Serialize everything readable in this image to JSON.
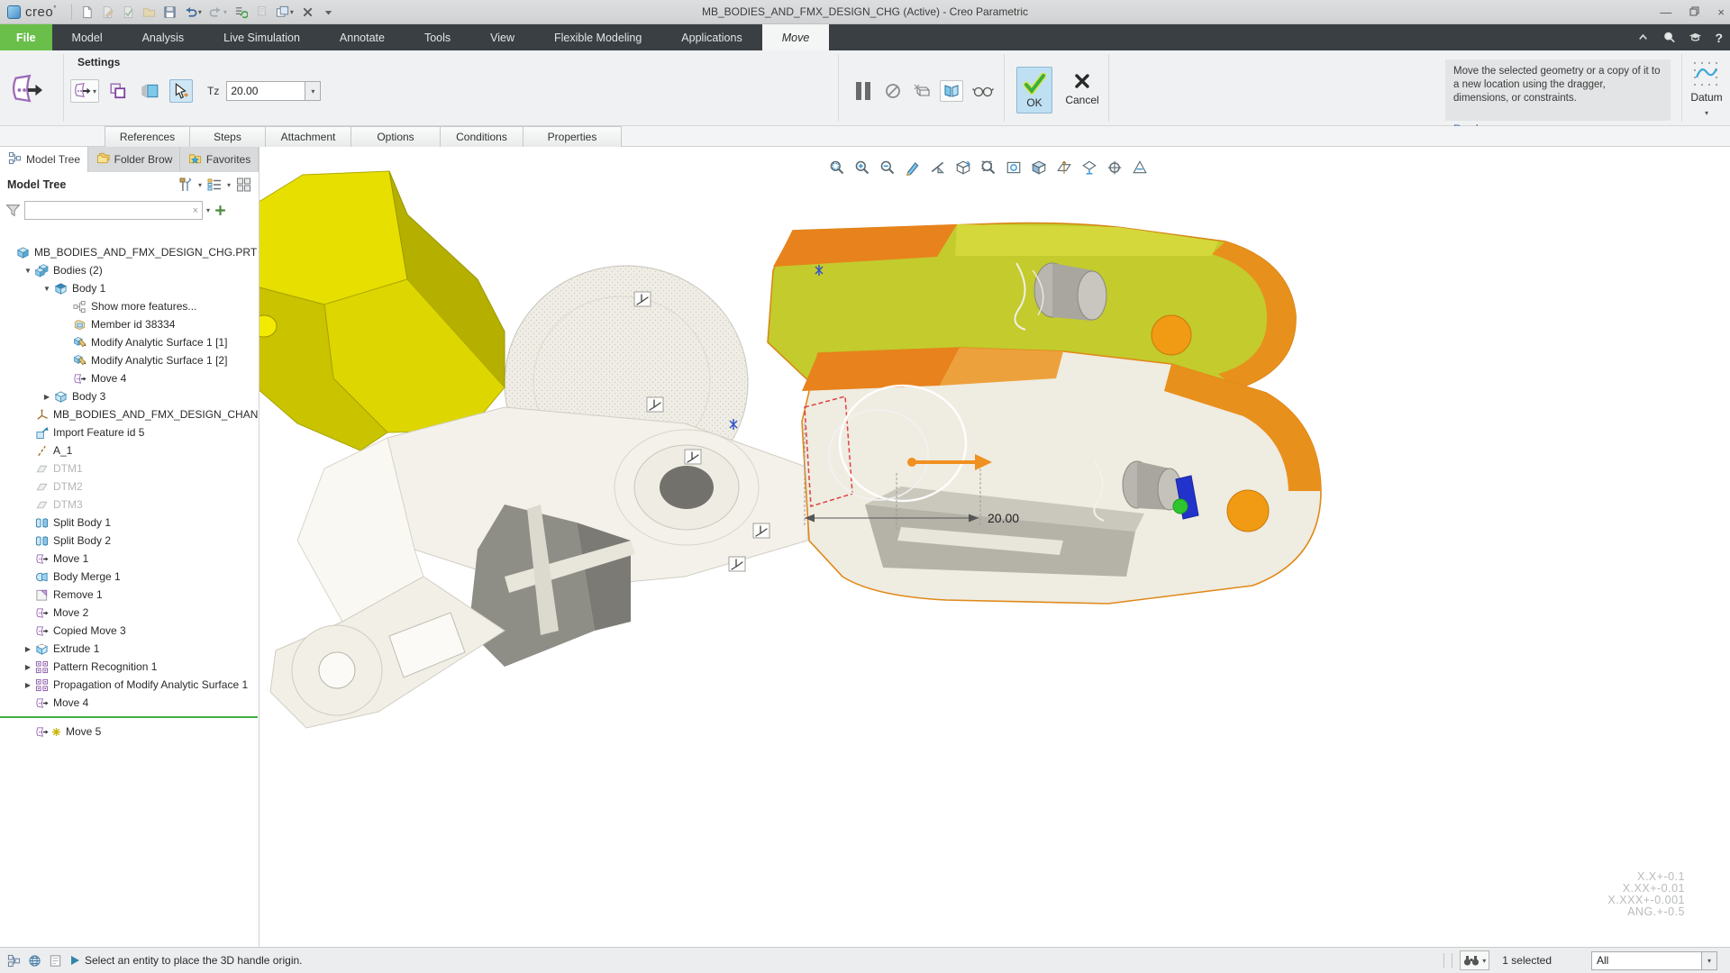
{
  "titlebar": {
    "title": "MB_BODIES_AND_FMX_DESIGN_CHG (Active) - Creo Parametric",
    "logo_text": "creo",
    "quickbar": [
      {
        "name": "new-file",
        "disabled": false
      },
      {
        "name": "sketch-file",
        "disabled": true
      },
      {
        "name": "validate-file",
        "disabled": true
      },
      {
        "name": "open-folder",
        "disabled": true
      },
      {
        "name": "save",
        "disabled": false
      },
      {
        "name": "undo",
        "disabled": false,
        "dropdown": true
      },
      {
        "name": "redo",
        "disabled": true,
        "dropdown": true
      },
      {
        "name": "regenerate",
        "disabled": false
      },
      {
        "name": "print",
        "disabled": true
      },
      {
        "name": "window-arrange",
        "disabled": false,
        "dropdown": true
      },
      {
        "name": "close-window",
        "disabled": false
      },
      {
        "name": "quickbar-customize",
        "disabled": false
      }
    ],
    "window_controls": [
      "minimize",
      "restore",
      "close"
    ]
  },
  "tabs": [
    {
      "label": "File",
      "type": "file"
    },
    {
      "label": "Model"
    },
    {
      "label": "Analysis"
    },
    {
      "label": "Live Simulation"
    },
    {
      "label": "Annotate"
    },
    {
      "label": "Tools"
    },
    {
      "label": "View"
    },
    {
      "label": "Flexible Modeling"
    },
    {
      "label": "Applications"
    },
    {
      "label": "Move",
      "active": true
    }
  ],
  "tabbar_icons": [
    "minimize-ribbon",
    "command-search",
    "learning-connector",
    "help"
  ],
  "ribbon": {
    "settings_label": "Settings",
    "tz_label": "Tz",
    "tz_value": "20.00",
    "ok_label": "OK",
    "cancel_label": "Cancel",
    "info_text": "Move the selected geometry or a copy of it to a new location using the dragger, dimensions, or constraints.",
    "read_more": "Read more...",
    "datum_label": "Datum"
  },
  "dashboard_tabs": [
    "References",
    "Steps",
    "Attachment",
    "Options",
    "Conditions",
    "Properties"
  ],
  "panel": {
    "tabs": [
      {
        "label": "Model Tree",
        "icon": "treetab",
        "active": true
      },
      {
        "label": "Folder Brow",
        "icon": "folders"
      },
      {
        "label": "Favorites",
        "icon": "favfolder"
      }
    ],
    "header": "Model Tree",
    "tree": [
      {
        "label": "MB_BODIES_AND_FMX_DESIGN_CHG.PRT",
        "icon": "part",
        "indent": 0
      },
      {
        "label": "Bodies (2)",
        "icon": "bodies",
        "indent": 1,
        "arrow": "down"
      },
      {
        "label": "Body 1",
        "icon": "body",
        "indent": 2,
        "arrow": "down"
      },
      {
        "label": "Show more features...",
        "icon": "more",
        "indent": 3
      },
      {
        "label": "Member id 38334",
        "icon": "member",
        "indent": 3
      },
      {
        "label": "Modify Analytic Surface 1 [1]",
        "icon": "modify",
        "indent": 3
      },
      {
        "label": "Modify Analytic Surface 1 [2]",
        "icon": "modify",
        "indent": 3
      },
      {
        "label": "Move 4",
        "icon": "move",
        "indent": 3
      },
      {
        "label": "Body 3",
        "icon": "body2",
        "indent": 2,
        "arrow": "right"
      },
      {
        "label": "MB_BODIES_AND_FMX_DESIGN_CHANGE",
        "icon": "csys",
        "indent": 1
      },
      {
        "label": "Import Feature id 5",
        "icon": "import",
        "indent": 1
      },
      {
        "label": "A_1",
        "icon": "axis",
        "indent": 1
      },
      {
        "label": "DTM1",
        "icon": "datum",
        "indent": 1,
        "grayed": true
      },
      {
        "label": "DTM2",
        "icon": "datum",
        "indent": 1,
        "grayed": true
      },
      {
        "label": "DTM3",
        "icon": "datum",
        "indent": 1,
        "grayed": true
      },
      {
        "label": "Split Body 1",
        "icon": "split",
        "indent": 1
      },
      {
        "label": "Split Body 2",
        "icon": "split",
        "indent": 1
      },
      {
        "label": "Move 1",
        "icon": "move",
        "indent": 1
      },
      {
        "label": "Body Merge 1",
        "icon": "merge",
        "indent": 1
      },
      {
        "label": "Remove 1",
        "icon": "remove",
        "indent": 1
      },
      {
        "label": "Move 2",
        "icon": "move",
        "indent": 1
      },
      {
        "label": "Copied Move 3",
        "icon": "move",
        "indent": 1
      },
      {
        "label": "Extrude 1",
        "icon": "extrude",
        "indent": 1,
        "arrow": "right"
      },
      {
        "label": "Pattern Recognition 1",
        "icon": "pattern",
        "indent": 1,
        "arrow": "right"
      },
      {
        "label": "Propagation of Modify Analytic Surface 1",
        "icon": "pattern",
        "indent": 1,
        "arrow": "right"
      },
      {
        "label": "Move 4",
        "icon": "move",
        "indent": 1
      },
      {
        "separator": true
      },
      {
        "label": "Move 5",
        "icon": "move",
        "indent": 1,
        "marker": "new"
      }
    ]
  },
  "viewport": {
    "dimension": "20.00",
    "accuracy": [
      "X.X+-0.1",
      "X.XX+-0.01",
      "X.XXX+-0.001",
      "ANG.+-0.5"
    ],
    "toolbar": [
      "zoom-selected",
      "zoom-in",
      "zoom-out",
      "repaint",
      "clipping",
      "reorient",
      "zoom-region",
      "saved-views",
      "display-style",
      "datum-display",
      "annotation-display",
      "spin-center",
      "perspective"
    ]
  },
  "statusbar": {
    "icons": [
      "model-tree-toggle",
      "web-browser",
      "message-log"
    ],
    "message": "Select an entity to place the 3D handle origin.",
    "selected": "1 selected",
    "filter_value": "All"
  },
  "colors": {
    "file_tab_green": "#6abf4b",
    "ok_highlight": "#bfe0f2",
    "insert_line_green": "#3cb043",
    "model_yellow": "#e4dd00",
    "model_olive": "#c3cb2d",
    "model_orange": "#e8821c",
    "dragger_orange": "#f09020"
  }
}
